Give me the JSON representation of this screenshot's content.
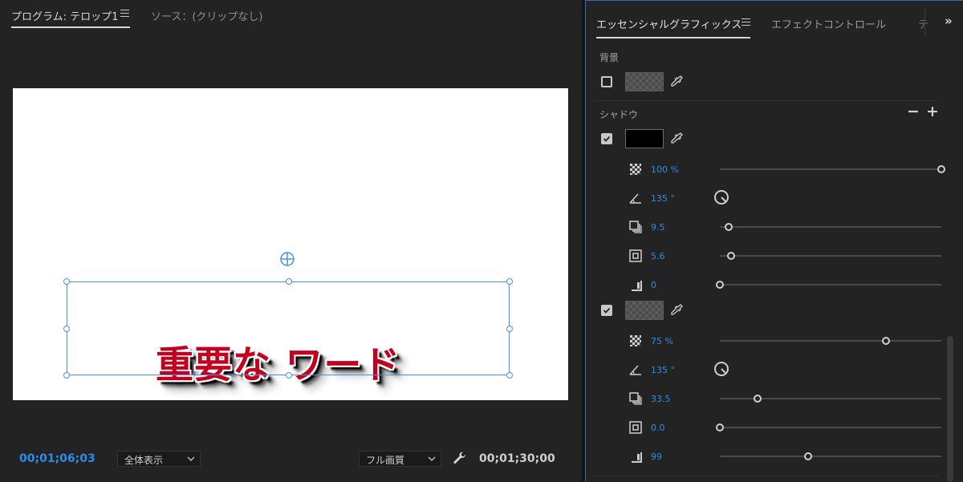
{
  "program_panel": {
    "tab_program": "プログラム: テロップ1",
    "tab_source": "ソース：(クリップなし)",
    "title_text": "重要な ワード",
    "timecode_current": "00;01;06;03",
    "zoom_select": "全体表示",
    "quality_select": "フル画質",
    "timecode_duration": "00;01;30;00"
  },
  "essential_graphics": {
    "tab_active": "エッセンシャルグラフィックス",
    "tab_effect_controls": "エフェクトコントロール",
    "tab_overflow": "テ",
    "overflow_arrows": "»",
    "background": {
      "label": "背景",
      "checked": false
    },
    "shadow": {
      "label": "シャドウ",
      "shadows": [
        {
          "checked": true,
          "color": "#000000",
          "opacity": "100 %",
          "opacity_fraction": 1.0,
          "angle": "135 °",
          "distance": "9.5",
          "distance_fraction": 0.04,
          "size": "5.6",
          "size_fraction": 0.05,
          "blur": "0",
          "blur_fraction": 0.0
        },
        {
          "checked": true,
          "color": "#5b5b5b",
          "opacity": "75 %",
          "opacity_fraction": 0.75,
          "angle": "135 °",
          "distance": "33.5",
          "distance_fraction": 0.17,
          "size": "0.0",
          "size_fraction": 0.0,
          "blur": "99",
          "blur_fraction": 0.4
        }
      ]
    }
  },
  "colors": {
    "accent_blue": "#2d8ceb",
    "title_fill": "#c3001d",
    "selection_blue": "#4a90e2"
  }
}
